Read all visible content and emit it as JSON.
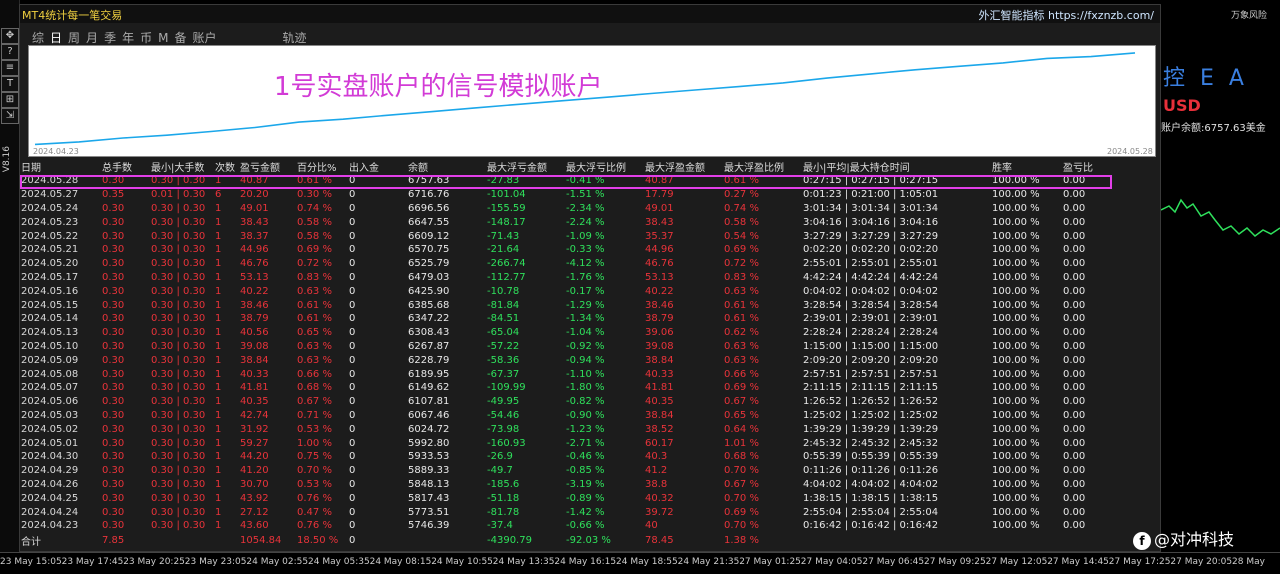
{
  "app": {
    "title": "MT4统计每一笔交易",
    "brand": "外汇智能指标 https://fxznzb.com/",
    "tabs": [
      "综",
      "日",
      "周",
      "月",
      "季",
      "年",
      "币",
      "M",
      "备",
      "账户",
      "轨迹"
    ],
    "active_tab": "日"
  },
  "leftbar": {
    "buttons": [
      "✥",
      "?",
      "≡",
      "T",
      "⊞",
      "⇲"
    ],
    "version": "V8.16"
  },
  "chart": {
    "title": "1号实盘账户的信号模拟账户",
    "start_label": "2024.04.23",
    "end_label": "2024.05.28",
    "line_color": "#1ba7ea"
  },
  "table": {
    "headers": [
      "日期",
      "总手数",
      "最小|大手数",
      "次数",
      "盈亏金额",
      "百分比%",
      "出入金",
      "余额",
      "最大浮亏金额",
      "最大浮亏比例",
      "最大浮盈金额",
      "最大浮盈比例",
      "最小|平均|最大持仓时间",
      "胜率",
      "盈亏比"
    ],
    "rows": [
      [
        "2024.05.28",
        "0.30",
        "0.30 | 0.30",
        "1",
        "40.87",
        "0.61 %",
        "0",
        "6757.63",
        "-27.83",
        "-0.41 %",
        "40.87",
        "0.61 %",
        "0:27:15 | 0:27:15 | 0:27:15",
        "100.00 %",
        "0.00"
      ],
      [
        "2024.05.27",
        "0.35",
        "0.01 | 0.30",
        "6",
        "20.20",
        "0.30 %",
        "0",
        "6716.76",
        "-101.04",
        "-1.51 %",
        "17.79",
        "0.27 %",
        "0:01:23 | 0:21:00 | 1:05:01",
        "100.00 %",
        "0.00"
      ],
      [
        "2024.05.24",
        "0.30",
        "0.30 | 0.30",
        "1",
        "49.01",
        "0.74 %",
        "0",
        "6696.56",
        "-155.59",
        "-2.34 %",
        "49.01",
        "0.74 %",
        "3:01:34 | 3:01:34 | 3:01:34",
        "100.00 %",
        "0.00"
      ],
      [
        "2024.05.23",
        "0.30",
        "0.30 | 0.30",
        "1",
        "38.43",
        "0.58 %",
        "0",
        "6647.55",
        "-148.17",
        "-2.24 %",
        "38.43",
        "0.58 %",
        "3:04:16 | 3:04:16 | 3:04:16",
        "100.00 %",
        "0.00"
      ],
      [
        "2024.05.22",
        "0.30",
        "0.30 | 0.30",
        "1",
        "38.37",
        "0.58 %",
        "0",
        "6609.12",
        "-71.43",
        "-1.09 %",
        "35.37",
        "0.54 %",
        "3:27:29 | 3:27:29 | 3:27:29",
        "100.00 %",
        "0.00"
      ],
      [
        "2024.05.21",
        "0.30",
        "0.30 | 0.30",
        "1",
        "44.96",
        "0.69 %",
        "0",
        "6570.75",
        "-21.64",
        "-0.33 %",
        "44.96",
        "0.69 %",
        "0:02:20 | 0:02:20 | 0:02:20",
        "100.00 %",
        "0.00"
      ],
      [
        "2024.05.20",
        "0.30",
        "0.30 | 0.30",
        "1",
        "46.76",
        "0.72 %",
        "0",
        "6525.79",
        "-266.74",
        "-4.12 %",
        "46.76",
        "0.72 %",
        "2:55:01 | 2:55:01 | 2:55:01",
        "100.00 %",
        "0.00"
      ],
      [
        "2024.05.17",
        "0.30",
        "0.30 | 0.30",
        "1",
        "53.13",
        "0.83 %",
        "0",
        "6479.03",
        "-112.77",
        "-1.76 %",
        "53.13",
        "0.83 %",
        "4:42:24 | 4:42:24 | 4:42:24",
        "100.00 %",
        "0.00"
      ],
      [
        "2024.05.16",
        "0.30",
        "0.30 | 0.30",
        "1",
        "40.22",
        "0.63 %",
        "0",
        "6425.90",
        "-10.78",
        "-0.17 %",
        "40.22",
        "0.63 %",
        "0:04:02 | 0:04:02 | 0:04:02",
        "100.00 %",
        "0.00"
      ],
      [
        "2024.05.15",
        "0.30",
        "0.30 | 0.30",
        "1",
        "38.46",
        "0.61 %",
        "0",
        "6385.68",
        "-81.84",
        "-1.29 %",
        "38.46",
        "0.61 %",
        "3:28:54 | 3:28:54 | 3:28:54",
        "100.00 %",
        "0.00"
      ],
      [
        "2024.05.14",
        "0.30",
        "0.30 | 0.30",
        "1",
        "38.79",
        "0.61 %",
        "0",
        "6347.22",
        "-84.51",
        "-1.34 %",
        "38.79",
        "0.61 %",
        "2:39:01 | 2:39:01 | 2:39:01",
        "100.00 %",
        "0.00"
      ],
      [
        "2024.05.13",
        "0.30",
        "0.30 | 0.30",
        "1",
        "40.56",
        "0.65 %",
        "0",
        "6308.43",
        "-65.04",
        "-1.04 %",
        "39.06",
        "0.62 %",
        "2:28:24 | 2:28:24 | 2:28:24",
        "100.00 %",
        "0.00"
      ],
      [
        "2024.05.10",
        "0.30",
        "0.30 | 0.30",
        "1",
        "39.08",
        "0.63 %",
        "0",
        "6267.87",
        "-57.22",
        "-0.92 %",
        "39.08",
        "0.63 %",
        "1:15:00 | 1:15:00 | 1:15:00",
        "100.00 %",
        "0.00"
      ],
      [
        "2024.05.09",
        "0.30",
        "0.30 | 0.30",
        "1",
        "38.84",
        "0.63 %",
        "0",
        "6228.79",
        "-58.36",
        "-0.94 %",
        "38.84",
        "0.63 %",
        "2:09:20 | 2:09:20 | 2:09:20",
        "100.00 %",
        "0.00"
      ],
      [
        "2024.05.08",
        "0.30",
        "0.30 | 0.30",
        "1",
        "40.33",
        "0.66 %",
        "0",
        "6189.95",
        "-67.37",
        "-1.10 %",
        "40.33",
        "0.66 %",
        "2:57:51 | 2:57:51 | 2:57:51",
        "100.00 %",
        "0.00"
      ],
      [
        "2024.05.07",
        "0.30",
        "0.30 | 0.30",
        "1",
        "41.81",
        "0.68 %",
        "0",
        "6149.62",
        "-109.99",
        "-1.80 %",
        "41.81",
        "0.69 %",
        "2:11:15 | 2:11:15 | 2:11:15",
        "100.00 %",
        "0.00"
      ],
      [
        "2024.05.06",
        "0.30",
        "0.30 | 0.30",
        "1",
        "40.35",
        "0.67 %",
        "0",
        "6107.81",
        "-49.95",
        "-0.82 %",
        "40.35",
        "0.67 %",
        "1:26:52 | 1:26:52 | 1:26:52",
        "100.00 %",
        "0.00"
      ],
      [
        "2024.05.03",
        "0.30",
        "0.30 | 0.30",
        "1",
        "42.74",
        "0.71 %",
        "0",
        "6067.46",
        "-54.46",
        "-0.90 %",
        "38.84",
        "0.65 %",
        "1:25:02 | 1:25:02 | 1:25:02",
        "100.00 %",
        "0.00"
      ],
      [
        "2024.05.02",
        "0.30",
        "0.30 | 0.30",
        "1",
        "31.92",
        "0.53 %",
        "0",
        "6024.72",
        "-73.98",
        "-1.23 %",
        "38.52",
        "0.64 %",
        "1:39:29 | 1:39:29 | 1:39:29",
        "100.00 %",
        "0.00"
      ],
      [
        "2024.05.01",
        "0.30",
        "0.30 | 0.30",
        "1",
        "59.27",
        "1.00 %",
        "0",
        "5992.80",
        "-160.93",
        "-2.71 %",
        "60.17",
        "1.01 %",
        "2:45:32 | 2:45:32 | 2:45:32",
        "100.00 %",
        "0.00"
      ],
      [
        "2024.04.30",
        "0.30",
        "0.30 | 0.30",
        "1",
        "44.20",
        "0.75 %",
        "0",
        "5933.53",
        "-26.9",
        "-0.46 %",
        "40.3",
        "0.68 %",
        "0:55:39 | 0:55:39 | 0:55:39",
        "100.00 %",
        "0.00"
      ],
      [
        "2024.04.29",
        "0.30",
        "0.30 | 0.30",
        "1",
        "41.20",
        "0.70 %",
        "0",
        "5889.33",
        "-49.7",
        "-0.85 %",
        "41.2",
        "0.70 %",
        "0:11:26 | 0:11:26 | 0:11:26",
        "100.00 %",
        "0.00"
      ],
      [
        "2024.04.26",
        "0.30",
        "0.30 | 0.30",
        "1",
        "30.70",
        "0.53 %",
        "0",
        "5848.13",
        "-185.6",
        "-3.19 %",
        "38.8",
        "0.67 %",
        "4:04:02 | 4:04:02 | 4:04:02",
        "100.00 %",
        "0.00"
      ],
      [
        "2024.04.25",
        "0.30",
        "0.30 | 0.30",
        "1",
        "43.92",
        "0.76 %",
        "0",
        "5817.43",
        "-51.18",
        "-0.89 %",
        "40.32",
        "0.70 %",
        "1:38:15 | 1:38:15 | 1:38:15",
        "100.00 %",
        "0.00"
      ],
      [
        "2024.04.24",
        "0.30",
        "0.30 | 0.30",
        "1",
        "27.12",
        "0.47 %",
        "0",
        "5773.51",
        "-81.78",
        "-1.42 %",
        "39.72",
        "0.69 %",
        "2:55:04 | 2:55:04 | 2:55:04",
        "100.00 %",
        "0.00"
      ],
      [
        "2024.04.23",
        "0.30",
        "0.30 | 0.30",
        "1",
        "43.60",
        "0.76 %",
        "0",
        "5746.39",
        "-37.4",
        "-0.66 %",
        "40",
        "0.70 %",
        "0:16:42 | 0:16:42 | 0:16:42",
        "100.00 %",
        "0.00"
      ]
    ],
    "totals": [
      "合计",
      "7.85",
      "",
      "",
      "1054.84",
      "18.50 %",
      "0",
      "",
      "-4390.79",
      "-92.03 %",
      "78.45",
      "1.38 %",
      "",
      "",
      ""
    ]
  },
  "right": {
    "top": "万象风险",
    "ea": "控 E A",
    "symbol": "USD",
    "balance": "账户余额:6757.63美金"
  },
  "timeaxis": [
    "23 May 15:05",
    "23 May 17:45",
    "23 May 20:25",
    "23 May 23:05",
    "24 May 02:55",
    "24 May 05:35",
    "24 May 08:15",
    "24 May 10:55",
    "24 May 13:35",
    "24 May 16:15",
    "24 May 18:55",
    "24 May 21:35",
    "27 May 01:25",
    "27 May 04:05",
    "27 May 06:45",
    "27 May 09:25",
    "27 May 12:05",
    "27 May 14:45",
    "27 May 17:25",
    "27 May 20:05",
    "28 May"
  ],
  "watermark": "@对冲科技",
  "colors": {
    "loss": "#e8333a",
    "profit": "#2fe05c",
    "highlight": "#e23fe9"
  }
}
